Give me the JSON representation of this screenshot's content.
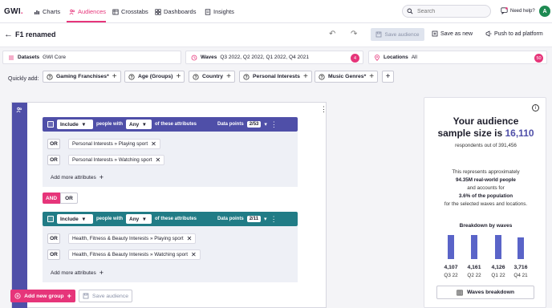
{
  "nav": {
    "logo": "GWI",
    "logo_dot": ".",
    "items": [
      {
        "label": "Charts"
      },
      {
        "label": "Audiences"
      },
      {
        "label": "Crosstabs"
      },
      {
        "label": "Dashboards"
      },
      {
        "label": "Insights"
      }
    ],
    "search_placeholder": "Search",
    "help": "Need help?",
    "avatar": "A",
    "accent": "#e6357a"
  },
  "titlebar": {
    "title": "F1 renamed",
    "save_audience": "Save audience",
    "save_as_new": "Save as new",
    "push": "Push to ad platform"
  },
  "filters": {
    "datasets_label": "Datasets",
    "datasets_value": "GWI Core",
    "waves_label": "Waves",
    "waves_value": "Q3 2022, Q2 2022, Q1 2022, Q4 2021",
    "waves_count": "4",
    "locations_label": "Locations",
    "locations_value": "All",
    "locations_count": "50"
  },
  "quick_add": {
    "label": "Quickly add:",
    "chips": [
      "Gaming Franchises*",
      "Age (Groups)",
      "Country",
      "Personal Interests",
      "Music Genres*"
    ]
  },
  "groups": [
    {
      "include": "Include",
      "people_with": "people with",
      "any": "Any",
      "of_these": "of these attributes",
      "dp_label": "Data points",
      "dp_value": "2/53",
      "color": "#4f4fa8",
      "attributes": [
        {
          "op": "OR",
          "text": "Personal Interests » Playing sport"
        },
        {
          "op": "OR",
          "text": "Personal Interests » Watching sport"
        }
      ],
      "add_more": "Add more attributes"
    },
    {
      "include": "Include",
      "people_with": "people with",
      "any": "Any",
      "of_these": "of these attributes",
      "dp_label": "Data points",
      "dp_value": "2/11",
      "color": "#217c86",
      "attributes": [
        {
          "op": "OR",
          "text": "Health, Fitness & Beauty Interests » Playing sport"
        },
        {
          "op": "OR",
          "text": "Health, Fitness & Beauty Interests » Watching sport"
        }
      ],
      "add_more": "Add more attributes"
    }
  ],
  "logic": {
    "and": "AND",
    "or": "OR"
  },
  "bottom": {
    "add_group": "Add new group",
    "save_audience": "Save audience"
  },
  "panel": {
    "line1": "Your audience",
    "line2_prefix": "sample size is",
    "sample_size": "16,110",
    "respondents": "respondents out of 391,456",
    "p1": "This represents approximately",
    "p2": "94.35M real-world people",
    "p3": "and accounts for",
    "p4": "3.6% of the population",
    "p5": "for the selected waves and locations.",
    "breakdown_title": "Breakdown by waves",
    "waves_breakdown": "Waves breakdown"
  },
  "chart_data": {
    "type": "bar",
    "title": "Breakdown by waves",
    "categories": [
      "Q3 22",
      "Q2 22",
      "Q1 22",
      "Q4 21"
    ],
    "values": [
      4107,
      4161,
      4126,
      3716
    ],
    "value_labels": [
      "4,107",
      "4,161",
      "4,126",
      "3,716"
    ],
    "color": "#5a64c8"
  }
}
